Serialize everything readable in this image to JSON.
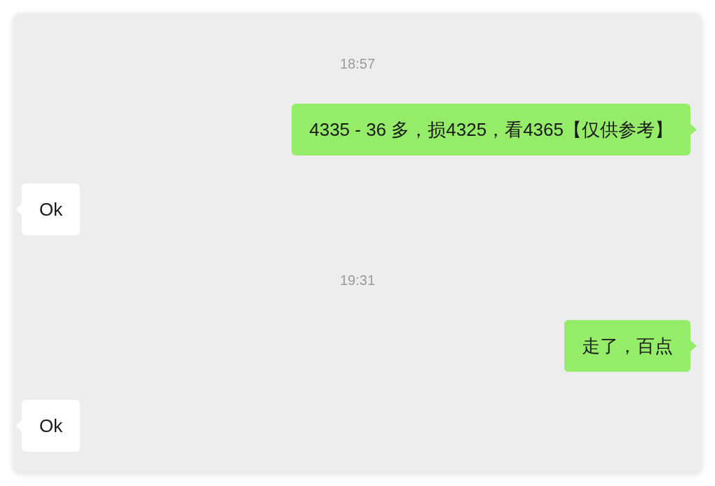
{
  "messages": [
    {
      "kind": "timestamp",
      "text": "18:57"
    },
    {
      "kind": "sent",
      "text": "4335 - 36 多，损4325，看4365【仅供参考】"
    },
    {
      "kind": "received",
      "text": "Ok"
    },
    {
      "kind": "timestamp",
      "text": "19:31"
    },
    {
      "kind": "sent",
      "text": "走了，百点"
    },
    {
      "kind": "received",
      "text": "Ok"
    }
  ]
}
